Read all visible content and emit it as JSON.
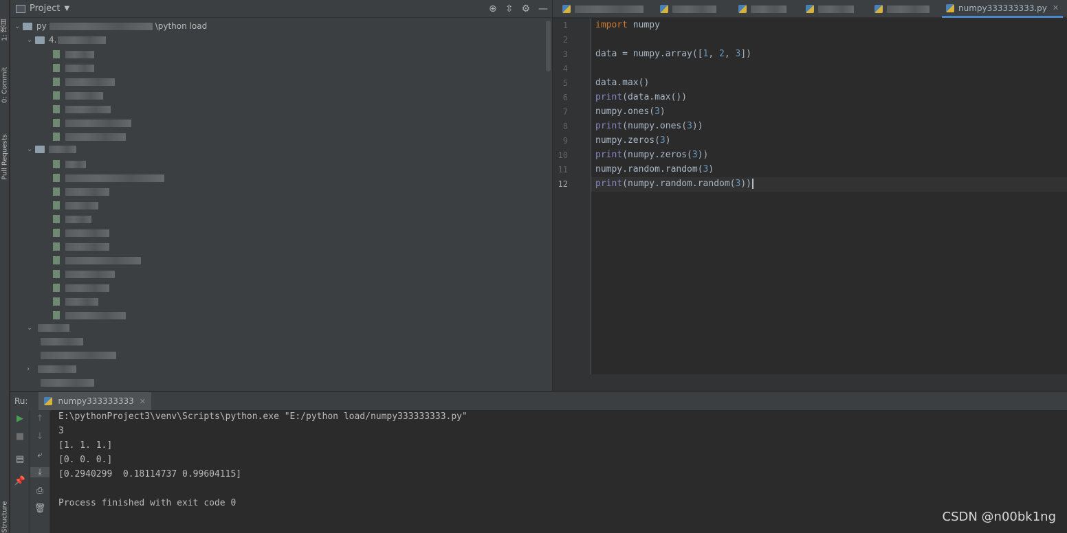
{
  "left_strip": {
    "project_label": "1: 项目",
    "commit_label": "0: Commit",
    "pull_requests_label": "Pull Requests",
    "structure_label": "Structure"
  },
  "project_panel": {
    "title": "Project",
    "root_prefix": "py",
    "root_suffix": "\\python load",
    "folder1_prefix": "4."
  },
  "tabs": [
    {
      "label": "anquanjiance..."
    },
    {
      "label": ""
    },
    {
      "label": ""
    },
    {
      "label": ""
    },
    {
      "label": ""
    },
    {
      "label": "numpy333333333.py"
    }
  ],
  "editor": {
    "line_numbers": [
      "1",
      "2",
      "3",
      "4",
      "5",
      "6",
      "7",
      "8",
      "9",
      "10",
      "11",
      "12"
    ],
    "current_line": 12
  },
  "run_panel": {
    "label": "Ru:",
    "tab_label": "numpy333333333"
  },
  "console": {
    "lines": [
      "E:\\pythonProject3\\venv\\Scripts\\python.exe \"E:/python load/numpy333333333.py\"",
      "3",
      "[1. 1. 1.]",
      "[0. 0. 0.]",
      "[0.2940299  0.18114737 0.99604115]",
      "",
      "Process finished with exit code 0"
    ]
  },
  "watermark": "CSDN @n00bk1ng",
  "colors": {
    "keyword": "#cc7832",
    "number": "#6897bb",
    "builtin": "#8888c6",
    "text": "#a9b7c6",
    "accent": "#4a88c7"
  },
  "icons": [
    "project-icon",
    "locate-icon",
    "collapse-icon",
    "gear-icon",
    "minimize-icon",
    "run-icon",
    "stop-icon",
    "scroll-up-icon",
    "scroll-down-icon",
    "soft-wrap-icon",
    "scroll-end-icon",
    "layout-icon",
    "pin-icon",
    "print-icon",
    "trash-icon"
  ]
}
